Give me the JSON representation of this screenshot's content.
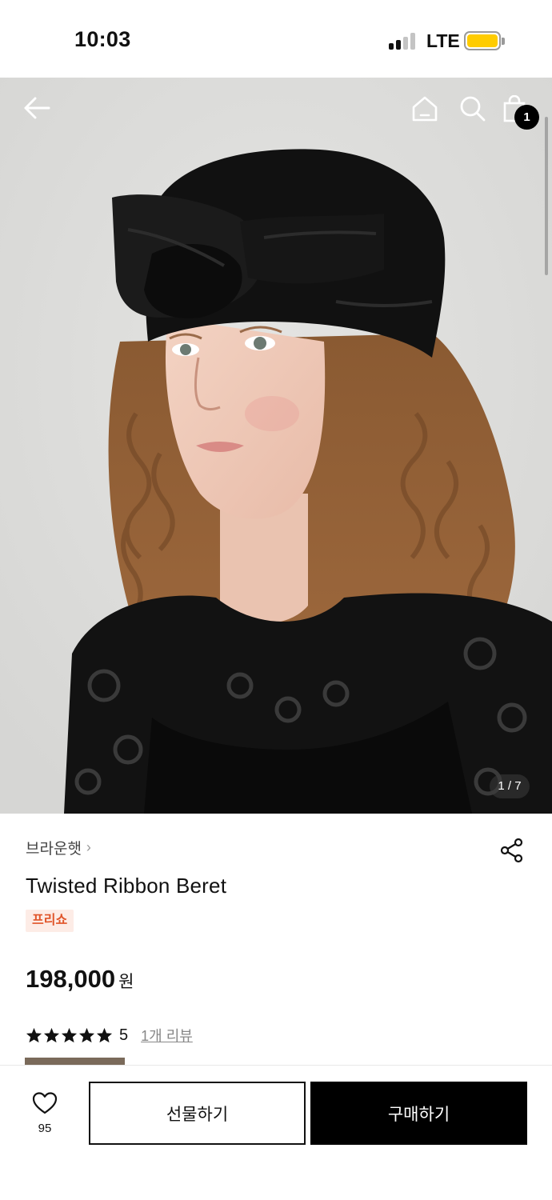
{
  "status_bar": {
    "time": "10:03",
    "network": "LTE",
    "signal_bars_active": 2,
    "battery_color": "#ffcc00"
  },
  "header": {
    "icons": [
      "back-arrow-icon",
      "home-icon",
      "search-icon",
      "shopping-bag-icon"
    ],
    "cart_count": "1"
  },
  "gallery": {
    "counter": "1 / 7",
    "current": 1,
    "total": 7
  },
  "product": {
    "brand": "브라운햇",
    "name": "Twisted Ribbon Beret",
    "tag": "프리쇼",
    "tag_color": "#e0552a",
    "price": "198,000",
    "currency": "원",
    "rating_score": "5",
    "rating_stars": 5,
    "review_link": "1개 리뷰"
  },
  "bottom_bar": {
    "like_count": "95",
    "gift_label": "선물하기",
    "buy_label": "구매하기"
  }
}
